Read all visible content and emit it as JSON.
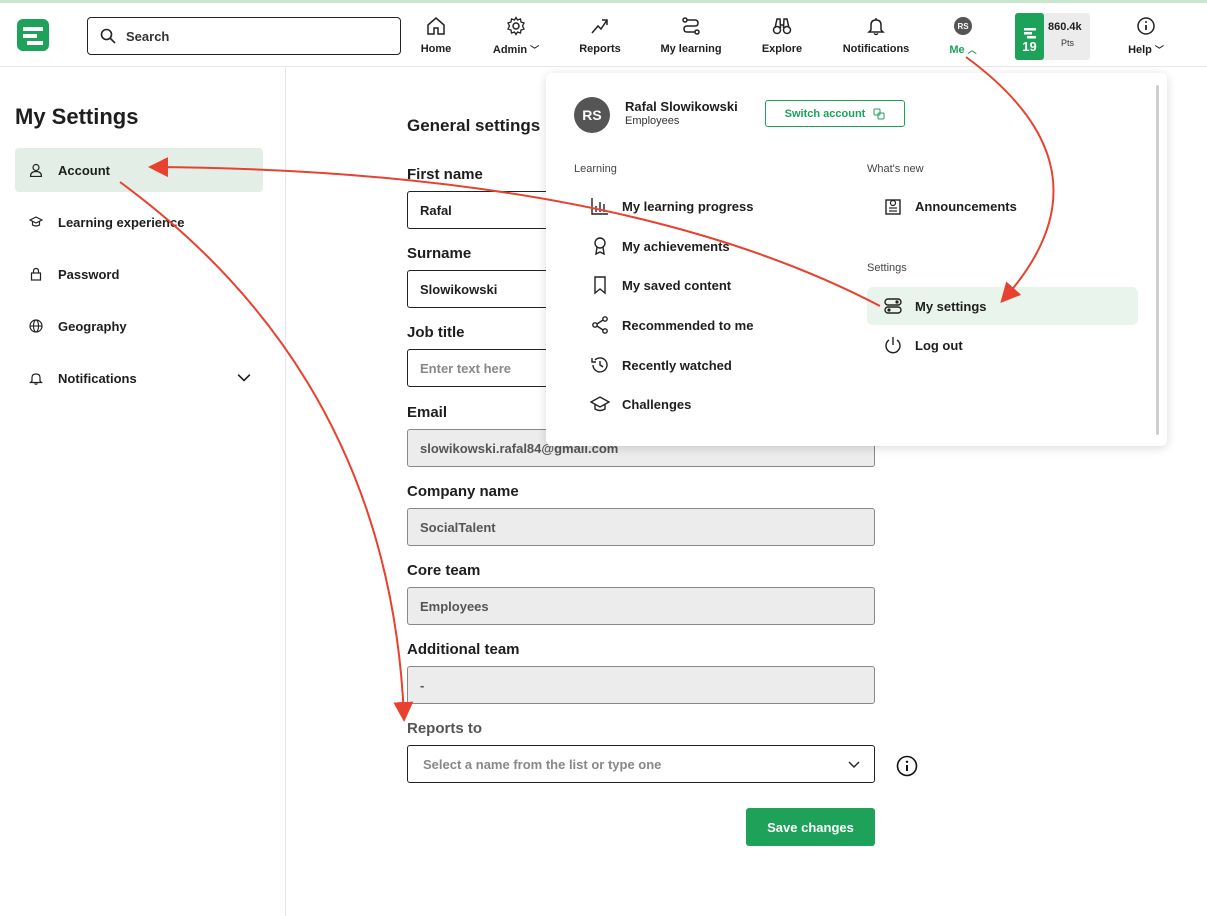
{
  "search": {
    "placeholder": "Search"
  },
  "nav": {
    "home": "Home",
    "admin": "Admin",
    "reports": "Reports",
    "my_learning": "My learning",
    "explore": "Explore",
    "notifications": "Notifications",
    "me": "Me",
    "me_initials": "RS",
    "help": "Help"
  },
  "points": {
    "streak": "19",
    "value": "860.4k",
    "unit": "Pts"
  },
  "sidebar": {
    "title": "My Settings",
    "items": [
      {
        "label": "Account",
        "icon": "user-icon",
        "active": true
      },
      {
        "label": "Learning experience",
        "icon": "graduation-cap-icon"
      },
      {
        "label": "Password",
        "icon": "lock-icon"
      },
      {
        "label": "Geography",
        "icon": "globe-icon"
      },
      {
        "label": "Notifications",
        "icon": "bell-icon",
        "expandable": true
      }
    ]
  },
  "form": {
    "title": "General settings",
    "first_name": {
      "label": "First name",
      "value": "Rafal"
    },
    "surname": {
      "label": "Surname",
      "value": "Slowikowski"
    },
    "job_title": {
      "label": "Job title",
      "placeholder": "Enter text here"
    },
    "email": {
      "label": "Email",
      "value": "slowikowski.rafal84@gmail.com"
    },
    "company": {
      "label": "Company name",
      "value": "SocialTalent"
    },
    "core_team": {
      "label": "Core team",
      "value": "Employees"
    },
    "additional_team": {
      "label": "Additional team",
      "value": "-"
    },
    "reports_to": {
      "label": "Reports to",
      "placeholder": "Select a name from the list or type one"
    },
    "save": "Save changes"
  },
  "dropdown": {
    "initials": "RS",
    "name": "Rafal Slowikowski",
    "team": "Employees",
    "switch_account": "Switch account",
    "learning_heading": "Learning",
    "learning_items": [
      "My learning progress",
      "My achievements",
      "My saved content",
      "Recommended to me",
      "Recently watched",
      "Challenges"
    ],
    "whats_new_heading": "What's new",
    "announcements": "Announcements",
    "settings_heading": "Settings",
    "my_settings": "My settings",
    "log_out": "Log out"
  },
  "colors": {
    "brand_green": "#1ea25a",
    "active_bg": "#e3efe6",
    "annotation_red": "#e8412f"
  }
}
